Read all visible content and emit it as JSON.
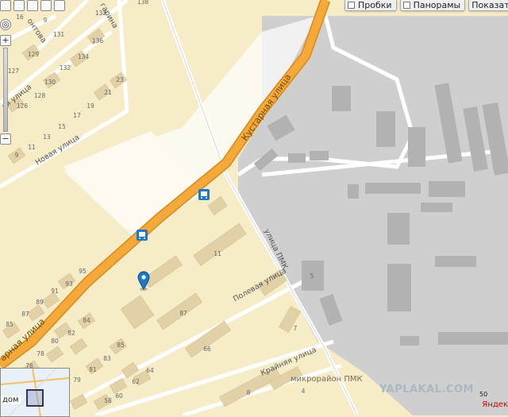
{
  "toolbar": {
    "traffic_label": "Пробки",
    "panoramas_label": "Панорамы",
    "show_label": "Показать"
  },
  "zoom": {
    "in_label": "+",
    "out_label": "−"
  },
  "streets": {
    "kustarnaya_top": "Кустарная улица",
    "kustarnaya_bottom": "арная улица",
    "pmk": "улица ПМК",
    "polevaya": "Полевая улица",
    "krainyaya": "Крайняя улица",
    "novaya_top": "ая улица",
    "novaya": "Новая улица",
    "dontova": "онтова",
    "garina": "гарина"
  },
  "district_label": "микрорайон ПМК",
  "house_numbers": {
    "h138": "138",
    "h133": "133",
    "h16": "16",
    "h9": "9",
    "h131": "131",
    "h136": "136",
    "h129": "129",
    "h134": "134",
    "h127": "127",
    "h132": "132",
    "h130": "130",
    "h23": "23",
    "h128": "128",
    "h126": "126",
    "h21": "21",
    "h19": "19",
    "h17": "17",
    "h15": "15",
    "h13": "13",
    "h11": "11",
    "h9b": "9",
    "h11b": "11",
    "h95": "95",
    "h93": "93",
    "h91": "91",
    "h89": "89",
    "h87": "87",
    "h85": "85",
    "h84": "84",
    "h82": "82",
    "h80": "80",
    "h78": "78",
    "h85b": "85",
    "h83": "83",
    "h81": "81",
    "h79": "79",
    "h76": "76",
    "h64": "64",
    "h62": "62",
    "h66": "66",
    "h87b": "87",
    "h7": "7",
    "h8": "8",
    "h5": "5",
    "h60": "60",
    "h58": "58",
    "h4": "4"
  },
  "minimap": {
    "home_label": "дом"
  },
  "watermark": "YAPLAKAL.COM",
  "brand": "Яндек",
  "scale_label": "50",
  "colors": {
    "land": "#f6ecc8",
    "industrial": "#cfcfcf",
    "building_res": "#e2d1a6",
    "building_ind": "#b2b2b2",
    "main_road": "#f5a93a",
    "minor_road": "#ffffff",
    "marker": "#1d78c8"
  }
}
